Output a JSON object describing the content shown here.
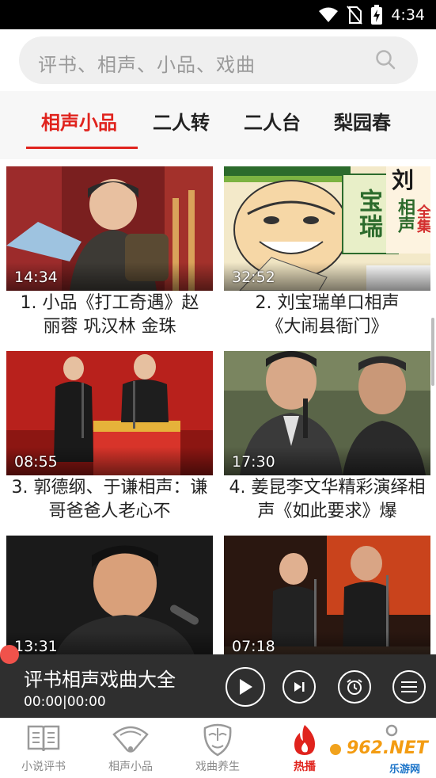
{
  "status_bar": {
    "time": "4:34"
  },
  "search": {
    "placeholder": "评书、相声、小品、戏曲"
  },
  "tabs": [
    {
      "label": "相声小品",
      "active": true
    },
    {
      "label": "二人转",
      "active": false
    },
    {
      "label": "二人台",
      "active": false
    },
    {
      "label": "梨园春",
      "active": false
    }
  ],
  "videos": [
    {
      "duration": "14:34",
      "caption": "1. 小品《打工奇遇》赵丽蓉 巩汉林 金珠"
    },
    {
      "duration": "32:52",
      "caption": "2. 刘宝瑞单口相声《大闹县衙门》"
    },
    {
      "duration": "08:55",
      "caption": "3. 郭德纲、于谦相声：谦哥爸爸人老心不"
    },
    {
      "duration": "17:30",
      "caption": "4. 姜昆李文华精彩演绎相声《如此要求》爆"
    },
    {
      "duration": "13:31",
      "caption": ""
    },
    {
      "duration": "07:18",
      "caption": ""
    }
  ],
  "thumbnail_text": {
    "poster_name": "宝瑞",
    "poster_sub": "相声",
    "poster_tag": "全集",
    "poster_top": "刘"
  },
  "player": {
    "title": "评书相声戏曲大全",
    "time": "00:00|00:00"
  },
  "bottom_nav": [
    {
      "label": "小说评书",
      "icon": "book-icon",
      "active": false
    },
    {
      "label": "相声小品",
      "icon": "fan-icon",
      "active": false
    },
    {
      "label": "戏曲养生",
      "icon": "opera-mask-icon",
      "active": false
    },
    {
      "label": "热播",
      "icon": "flame-icon",
      "active": true
    },
    {
      "label": "",
      "icon": "user-icon",
      "active": false
    }
  ],
  "watermark": {
    "text": "962.NET",
    "sub": "乐游网"
  },
  "colors": {
    "accent": "#e0231d",
    "player_bg": "#2f2f2f",
    "tabs_bg": "#f7f7f7"
  }
}
